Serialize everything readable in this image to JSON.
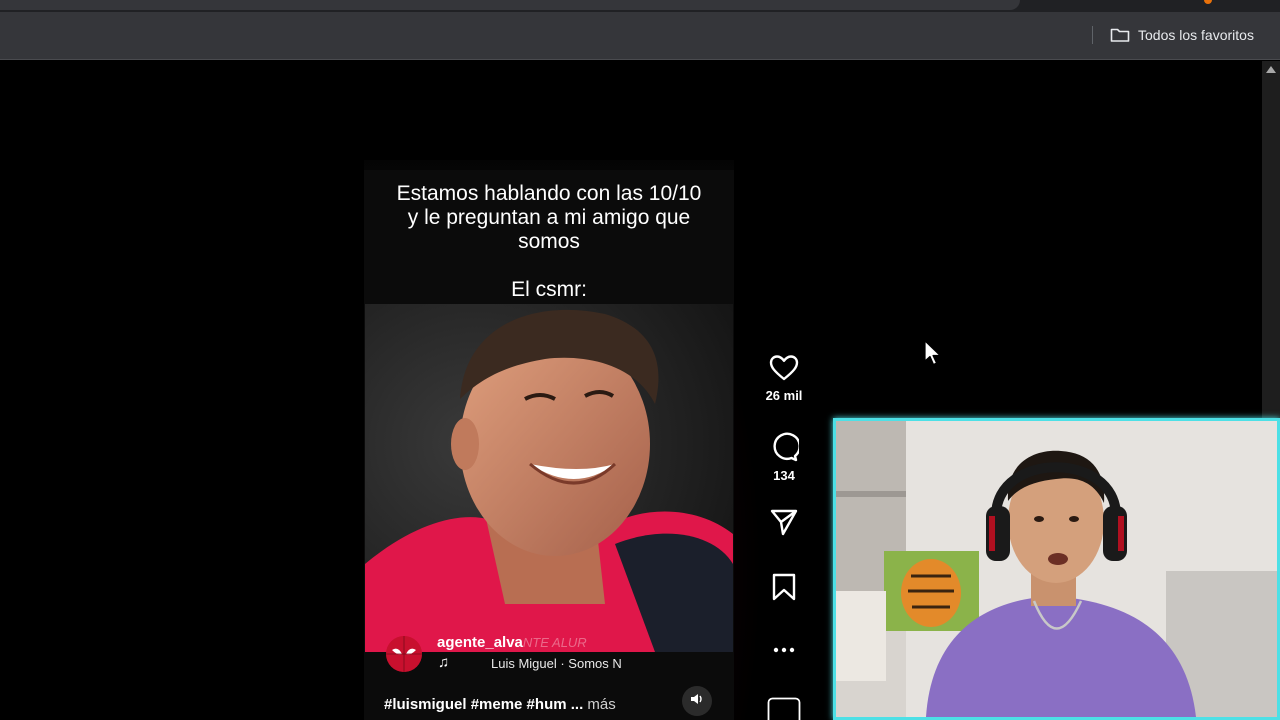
{
  "browser": {
    "bookmarks_label": "Todos los favoritos"
  },
  "reel": {
    "caption": "Estamos hablando con las 10/10 y le preguntan a mi amigo que somos",
    "caption_line2": "El csmr:",
    "username": "agente_alva",
    "username_overlay": "NTE ALUR",
    "music_icon": "♫",
    "music": "Luis Miguel · Somos N",
    "hashtags": "#luismiguel #meme #hum ...",
    "more": "más"
  },
  "actions": {
    "likes": "26 mil",
    "comments": "134"
  },
  "icons": {
    "bookmarks": "folder-icon",
    "like": "heart-icon",
    "comment": "comment-icon",
    "share": "send-icon",
    "save": "bookmark-icon",
    "options": "more-icon",
    "audio": "sound-icon"
  },
  "colors": {
    "webcam_border": "#4de0e6",
    "page_bg": "#000000",
    "chrome_bg": "#35363a"
  }
}
